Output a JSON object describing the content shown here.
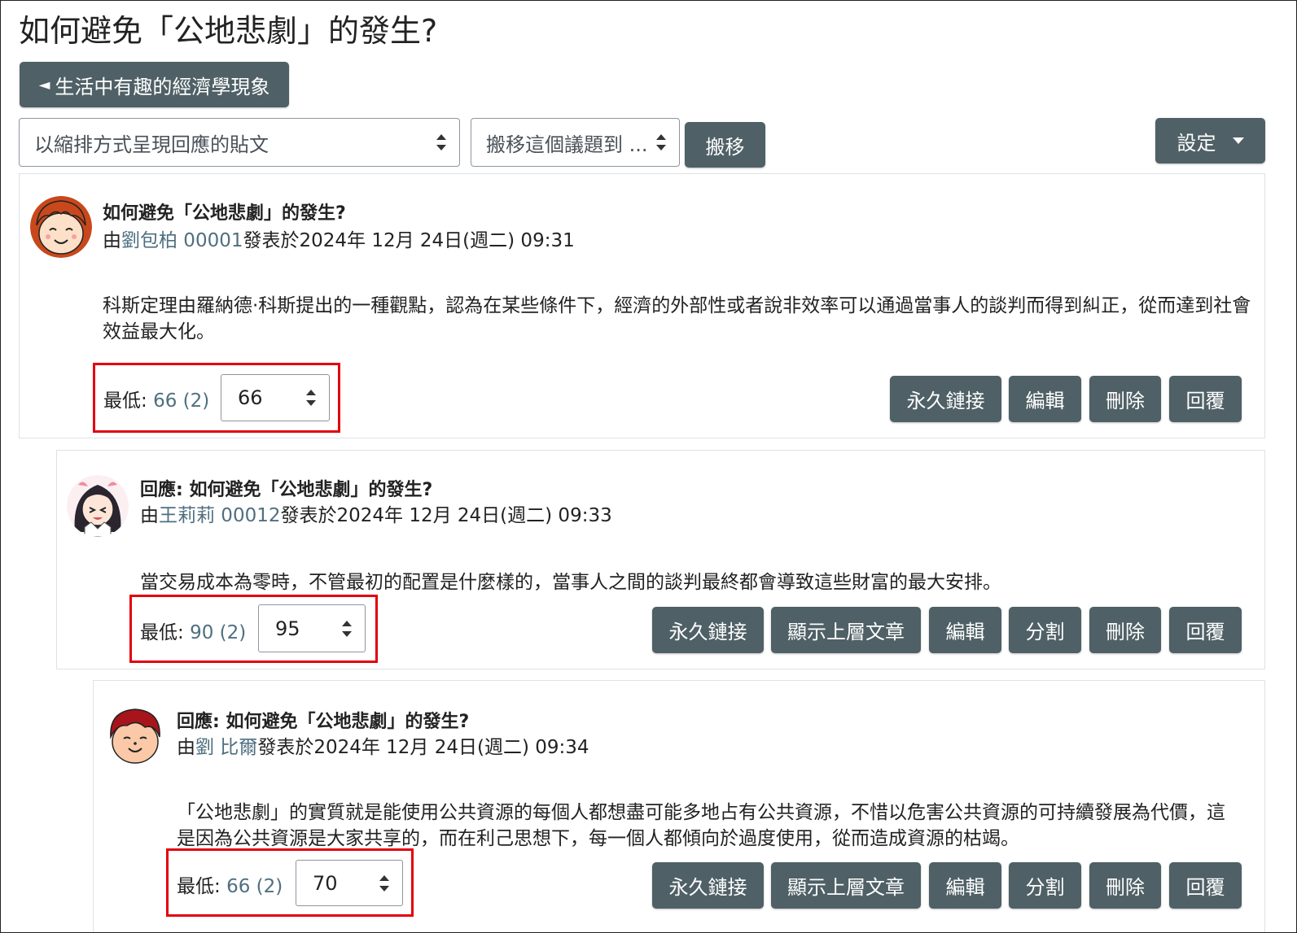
{
  "page_title": "如何避免「公地悲劇」的發生?",
  "back_button": {
    "arrow": "◄",
    "label": "生活中有趣的經濟學現象"
  },
  "display_mode": {
    "selected": "以縮排方式呈現回應的貼文"
  },
  "move_discussion": {
    "selected": "搬移這個議題到 ...",
    "button_label": "搬移"
  },
  "settings_label": "設定",
  "posts": [
    {
      "subject": "如何避免「公地悲劇」的發生?",
      "by_prefix": "由",
      "author": "劉包柏 00001",
      "posted": "發表於2024年 12月 24日(週二) 09:31",
      "body": "科斯定理由羅納德·科斯提出的一種觀點，認為在某些條件下，經濟的外部性或者說非效率可以通過當事人的談判而得到糾正，從而達到社會效益最大化。",
      "rating_label": "最低:",
      "rating_aggregate": "66 (2)",
      "rating_value": "66",
      "actions": [
        "永久鏈接",
        "編輯",
        "刪除",
        "回覆"
      ]
    },
    {
      "subject": "回應: 如何避免「公地悲劇」的發生?",
      "by_prefix": "由",
      "author": "王莉莉 00012",
      "posted": "發表於2024年 12月 24日(週二) 09:33",
      "body": "當交易成本為零時，不管最初的配置是什麼樣的，當事人之間的談判最終都會導致這些財富的最大安排。",
      "rating_label": "最低:",
      "rating_aggregate": "90 (2)",
      "rating_value": "95",
      "actions": [
        "永久鏈接",
        "顯示上層文章",
        "編輯",
        "分割",
        "刪除",
        "回覆"
      ]
    },
    {
      "subject": "回應: 如何避免「公地悲劇」的發生?",
      "by_prefix": "由",
      "author": "劉 比爾",
      "posted": "發表於2024年 12月 24日(週二) 09:34",
      "body": "「公地悲劇」的實質就是能使用公共資源的每個人都想盡可能多地占有公共資源，不惜以危害公共資源的可持續發展為代價，這是因為公共資源是大家共享的，而在利己思想下，每一個人都傾向於過度使用，從而造成資源的枯竭。",
      "rating_label": "最低:",
      "rating_aggregate": "66 (2)",
      "rating_value": "70",
      "actions": [
        "永久鏈接",
        "顯示上層文章",
        "編輯",
        "分割",
        "刪除",
        "回覆"
      ]
    }
  ],
  "highlight_color": "#e3000f",
  "button_color": "#4f6066",
  "link_color": "#4f6f80"
}
